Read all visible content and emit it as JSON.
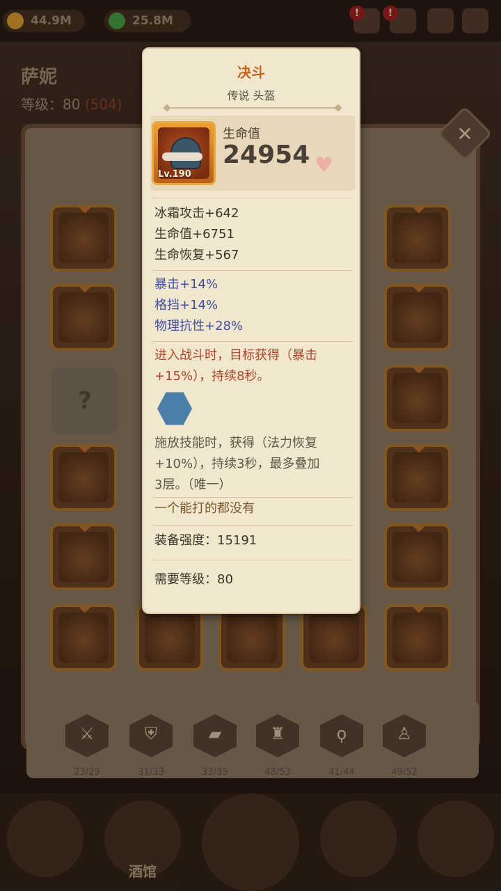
{
  "resources": {
    "gold": "44.9M",
    "gem": "25.8M",
    "gold_color": "#c38a2a",
    "gem_color": "#3f8a3a"
  },
  "hero": {
    "name": "萨妮",
    "level_label": "等级：80",
    "level_extra": "(504)"
  },
  "alerts": [
    "!",
    "!"
  ],
  "tooltip": {
    "title": "决斗",
    "subtitle": "传说 头盔",
    "item_level": "Lv.190",
    "main_stat_label": "生命值",
    "main_stat_value": "24954",
    "base_stats": [
      "冰霜攻击+642",
      "生命值+6751",
      "生命恢复+567"
    ],
    "bonus_stats": [
      "暴击+14%",
      "格挡+14%",
      "物理抗性+28%"
    ],
    "effect_1": [
      "进入战斗时，目标获得（暴击",
      "+15%），持续8秒。"
    ],
    "effect_2": [
      "施放技能时，获得（法力恢复",
      "+10%），持续3秒，最多叠加",
      "3层。（唯一）"
    ],
    "flavor": "一个能打的都没有",
    "gear_score": "装备强度：15191",
    "required_level": "需要等级：80",
    "title_color": "#c8621b",
    "bonus_color": "#3f4fa0",
    "effect_color": "#b0452a"
  },
  "close_label": "✕",
  "empty_slot_label": "?",
  "tabs": [
    {
      "icon": "sword-icon",
      "glyph": "⚔",
      "count": "23/29"
    },
    {
      "icon": "shield-icon",
      "glyph": "⛨",
      "count": "31/33"
    },
    {
      "icon": "book-icon",
      "glyph": "▰",
      "count": "33/35"
    },
    {
      "icon": "helmet-icon",
      "glyph": "♜",
      "count": "48/53"
    },
    {
      "icon": "necklace-icon",
      "glyph": "ϙ",
      "count": "41/44"
    },
    {
      "icon": "armor-icon",
      "glyph": "♙",
      "count": "49/52"
    }
  ],
  "nav": {
    "tavern_label": "酒馆"
  }
}
